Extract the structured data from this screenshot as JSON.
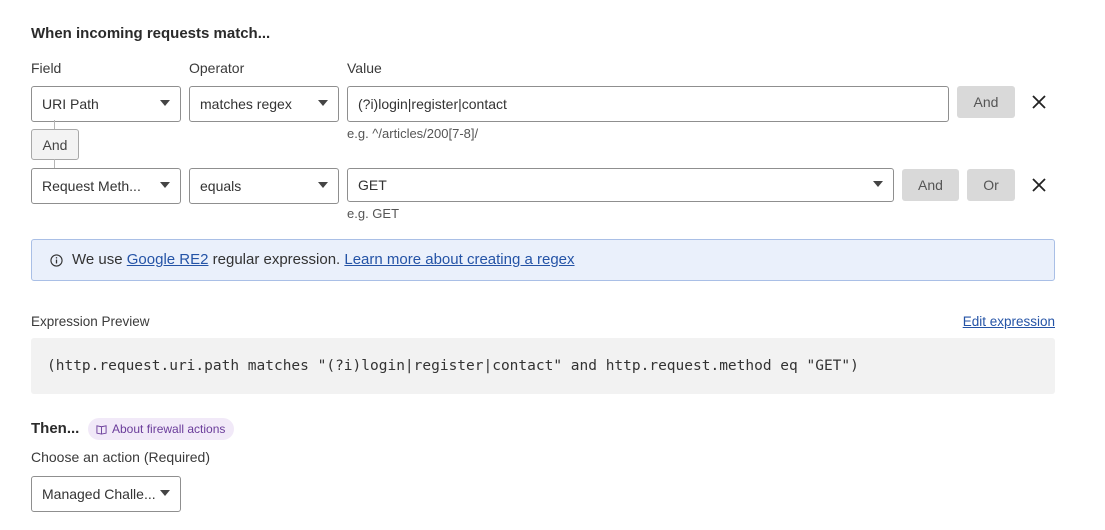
{
  "section": {
    "title": "When incoming requests match..."
  },
  "columns": {
    "field": "Field",
    "operator": "Operator",
    "value": "Value"
  },
  "row1": {
    "field": "URI Path",
    "operator": "matches regex",
    "value": "(?i)login|register|contact",
    "hint": "e.g. ^/articles/200[7-8]/",
    "and_label": "And"
  },
  "connector": {
    "label": "And"
  },
  "row2": {
    "field": "Request Meth...",
    "operator": "equals",
    "value": "GET",
    "hint": "e.g. GET",
    "and_label": "And",
    "or_label": "Or"
  },
  "info": {
    "prefix": "We use ",
    "link1": "Google RE2",
    "middle": " regular expression. ",
    "link2": "Learn more about creating a regex"
  },
  "preview": {
    "label": "Expression Preview",
    "edit_link": "Edit expression",
    "expression": "(http.request.uri.path matches \"(?i)login|register|contact\" and http.request.method eq \"GET\")"
  },
  "then": {
    "title": "Then...",
    "about_link": "About firewall actions",
    "action_label": "Choose an action (Required)",
    "action_value": "Managed Challe..."
  },
  "icons": {
    "info": "info-icon",
    "close": "close-icon",
    "book": "book-icon",
    "dropdown": "chevron-down-icon"
  }
}
